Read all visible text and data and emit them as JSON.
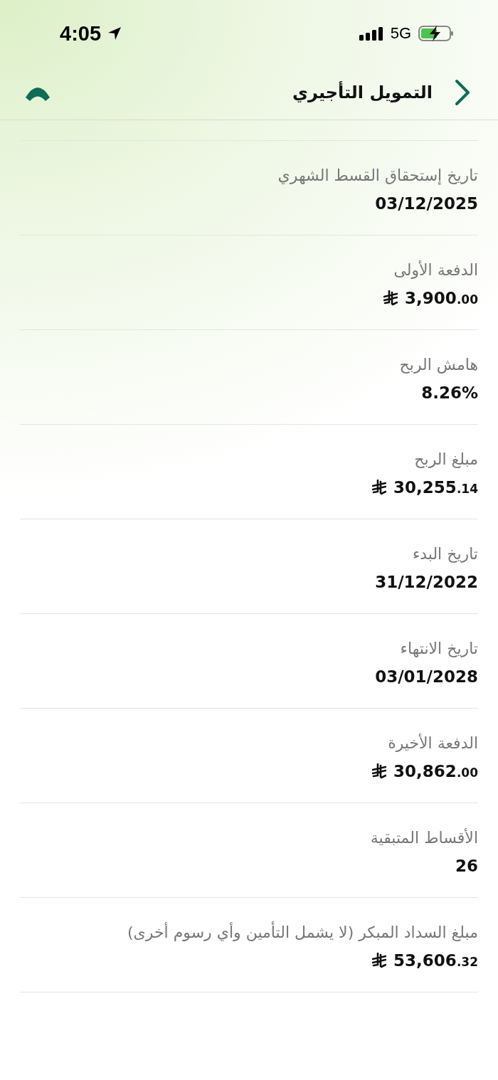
{
  "status_bar": {
    "time": "4:05",
    "network": "5G"
  },
  "header": {
    "title": "التمويل التأجيري"
  },
  "rows": [
    {
      "label": "تاريخ إستحقاق القسط الشهري",
      "kind": "text",
      "value": "03/12/2025"
    },
    {
      "label": "الدفعة الأولى",
      "kind": "amount",
      "whole": "3,900",
      "fraction": ".00"
    },
    {
      "label": "هامش الربح",
      "kind": "text",
      "value": "8.26%"
    },
    {
      "label": "مبلغ الربح",
      "kind": "amount",
      "whole": "30,255",
      "fraction": ".14"
    },
    {
      "label": "تاريخ البدء",
      "kind": "text",
      "value": "31/12/2022"
    },
    {
      "label": "تاريخ الانتهاء",
      "kind": "text",
      "value": "03/01/2028"
    },
    {
      "label": "الدفعة الأخيرة",
      "kind": "amount",
      "whole": "30,862",
      "fraction": ".00"
    },
    {
      "label": "الأقساط المتبقية",
      "kind": "text",
      "value": "26"
    },
    {
      "label": "مبلغ السداد المبكر (لا يشمل التأمين وأي رسوم أخرى)",
      "kind": "amount",
      "whole": "53,606",
      "fraction": ".32"
    }
  ]
}
